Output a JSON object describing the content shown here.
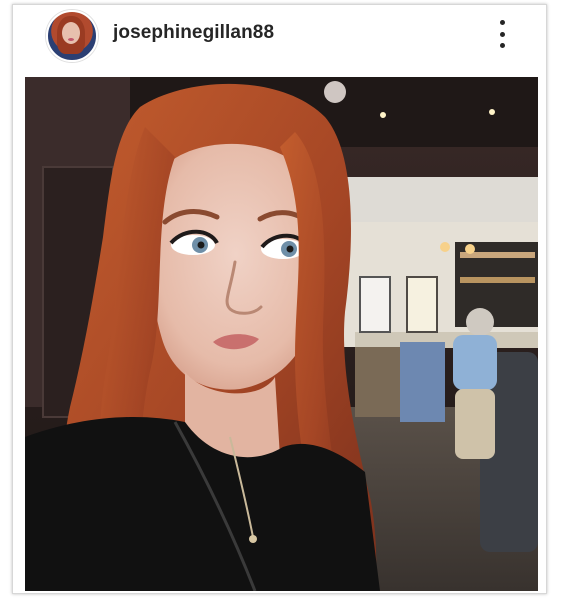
{
  "post": {
    "username": "josephinegillan88",
    "avatar_icon": "profile-avatar",
    "menu_icon": "more-options-vertical-icon",
    "photo_icon": "selfie-photo"
  },
  "colors": {
    "username": "#262626",
    "hair": "#b4552b",
    "background_wall": "#2d2322"
  }
}
